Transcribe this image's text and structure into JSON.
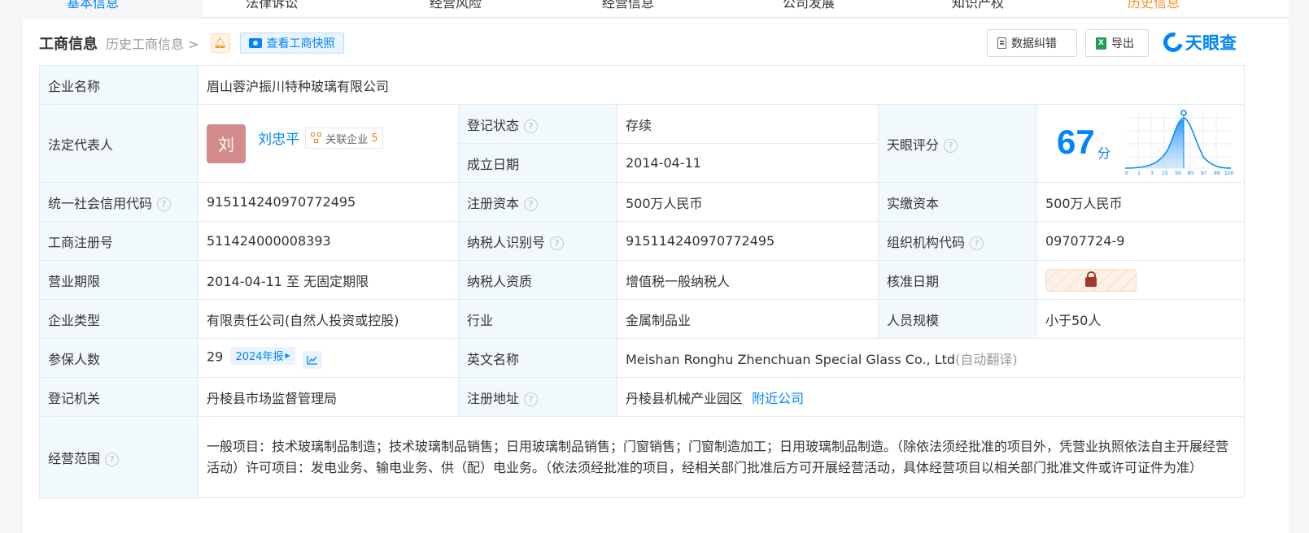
{
  "tabs": [
    {
      "label": "基本信息",
      "active": true
    },
    {
      "label": "法律诉讼"
    },
    {
      "label": "经营风险"
    },
    {
      "label": "经营信息"
    },
    {
      "label": "公司发展"
    },
    {
      "label": "知识产权"
    },
    {
      "label": "历史信息",
      "accent": true
    }
  ],
  "header": {
    "title": "工商信息",
    "history_link": "历史工商信息",
    "history_arrow": ">",
    "snapshot_button": "查看工商快照",
    "correct_button": "数据纠错",
    "export_button": "导出",
    "logo_text": "天眼查",
    "xls_letter": "X"
  },
  "colors": {
    "primary": "#0084ff",
    "label_bg": "#f2f9fc",
    "status_green": "#13a35b",
    "accent_orange": "#f5860b"
  },
  "icons": {
    "bell": "bell-icon",
    "camera": "camera-icon",
    "help": "question-circle-icon",
    "lock": "lock-icon",
    "trend": "line-chart-icon",
    "relation": "relation-graph-icon"
  },
  "info": {
    "company_name_label": "企业名称",
    "company_name": "眉山蓉沪振川特种玻璃有限公司",
    "legal_rep_label": "法定代表人",
    "legal_rep_avatar": "刘",
    "legal_rep_name": "刘忠平",
    "related_label": "关联企业",
    "related_count": "5",
    "reg_status_label": "登记状态",
    "reg_status": "存续",
    "established_label": "成立日期",
    "established": "2014-04-11",
    "score_label": "天眼评分",
    "score": "67",
    "score_unit": "分",
    "score_axis": [
      "0",
      "1",
      "3",
      "15",
      "50",
      "85",
      "97",
      "99",
      "100"
    ],
    "credit_code_label": "统一社会信用代码",
    "credit_code": "915114240970772495",
    "reg_capital_label": "注册资本",
    "reg_capital": "500万人民币",
    "paid_capital_label": "实缴资本",
    "paid_capital": "500万人民币",
    "biz_reg_no_label": "工商注册号",
    "biz_reg_no": "511424000008393",
    "taxpayer_id_label": "纳税人识别号",
    "taxpayer_id": "915114240970772495",
    "org_code_label": "组织机构代码",
    "org_code": "09707724-9",
    "biz_term_label": "营业期限",
    "biz_term": "2014-04-11 至 无固定期限",
    "taxpayer_qual_label": "纳税人资质",
    "taxpayer_qual": "增值税一般纳税人",
    "approval_date_label": "核准日期",
    "company_type_label": "企业类型",
    "company_type": "有限责任公司(自然人投资或控股)",
    "industry_label": "行业",
    "industry": "金属制品业",
    "staff_size_label": "人员规模",
    "staff_size": "小于50人",
    "insured_label": "参保人数",
    "insured": "29",
    "insured_year": "2024年报",
    "english_name_label": "英文名称",
    "english_name": "Meishan Ronghu Zhenchuan Special Glass Co., Ltd",
    "english_name_note": "(自动翻译)",
    "reg_authority_label": "登记机关",
    "reg_authority": "丹棱县市场监督管理局",
    "reg_address_label": "注册地址",
    "reg_address": "丹棱县机械产业园区",
    "nearby_link": "附近公司",
    "scope_label": "经营范围",
    "scope": "一般项目：技术玻璃制品制造；技术玻璃制品销售；日用玻璃制品销售；门窗销售；门窗制造加工；日用玻璃制品制造。（除依法须经批准的项目外，凭营业执照依法自主开展经营活动）许可项目：发电业务、输电业务、供（配）电业务。（依法须经批准的项目，经相关部门批准后方可开展经营活动，具体经营项目以相关部门批准文件或许可证件为准）"
  }
}
